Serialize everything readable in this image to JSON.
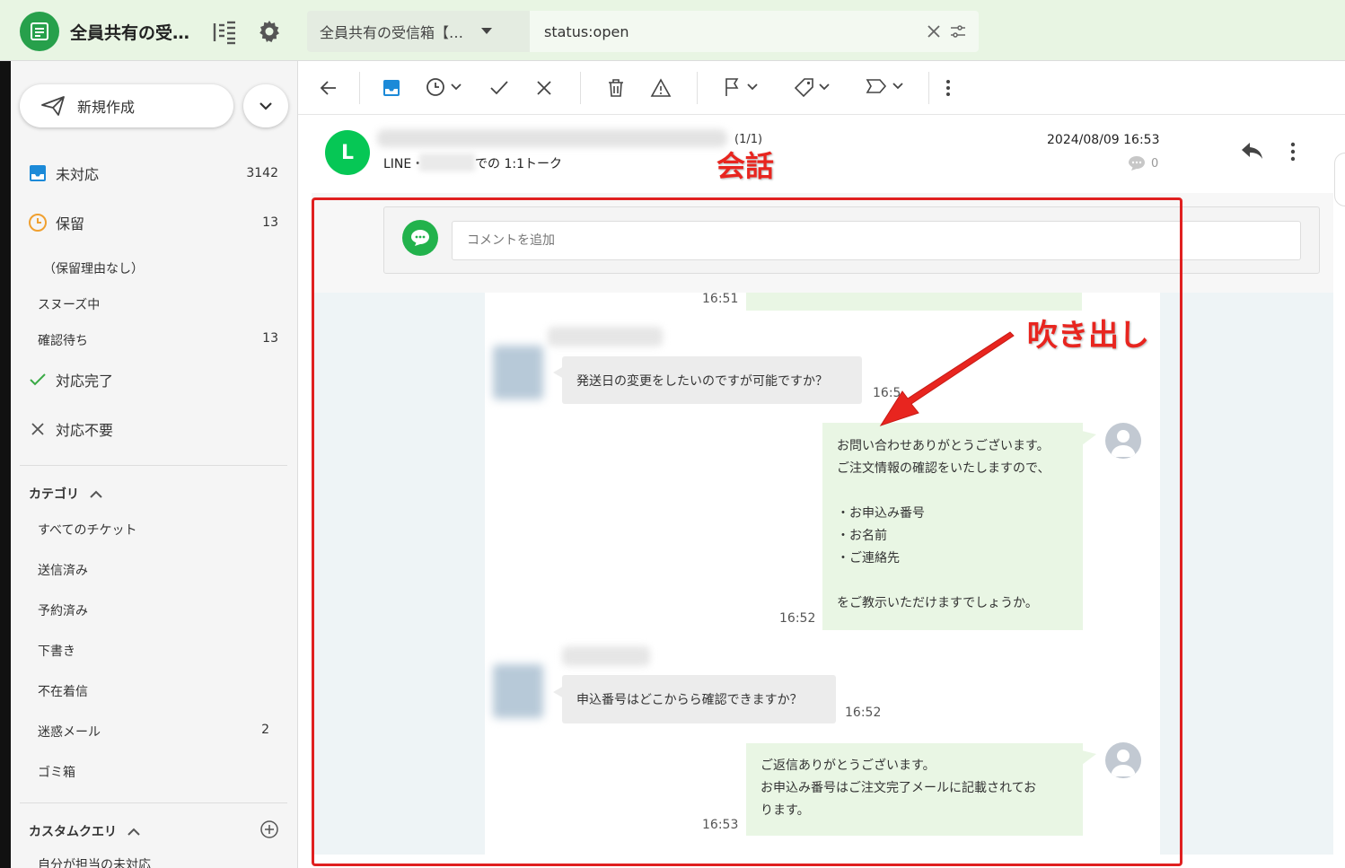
{
  "app": {
    "title": "全員共有の受…"
  },
  "compose": {
    "label": "新規作成"
  },
  "nav": [
    {
      "label": "未対応",
      "count": "3142"
    },
    {
      "label": "保留",
      "count": "13"
    },
    {
      "label": "対応完了"
    },
    {
      "label": "対応不要"
    }
  ],
  "hold_sub": [
    {
      "label": "（保留理由なし）"
    },
    {
      "label": "スヌーズ中"
    },
    {
      "label": "確認待ち",
      "count": "13"
    }
  ],
  "category": {
    "heading": "カテゴリ",
    "items": [
      {
        "label": "すべてのチケット"
      },
      {
        "label": "送信済み"
      },
      {
        "label": "予約済み"
      },
      {
        "label": "下書き"
      },
      {
        "label": "不在着信"
      },
      {
        "label": "迷惑メール",
        "count": "2"
      },
      {
        "label": "ゴミ箱"
      }
    ]
  },
  "custom_query": {
    "heading": "カスタムクエリ",
    "first_item": "自分が担当の未対応"
  },
  "topbar": {
    "inbox": "全員共有の受信箱【…",
    "search": "status:open"
  },
  "header": {
    "avatar_letter": "L",
    "page_count": "(1/1)",
    "line_prefix": "LINE・",
    "talk_label": "での 1:1トーク",
    "date": "2024/08/09 16:53",
    "comment_count": "0"
  },
  "annotations": {
    "kaiwa": "会話",
    "fukidashi": "吹き出し"
  },
  "comment": {
    "placeholder": "コメントを追加"
  },
  "messages": {
    "t0": "16:51",
    "m1": {
      "text": "発送日の変更をしたいのですが可能ですか？",
      "time": "16:5"
    },
    "m2": {
      "lines": [
        "お問い合わせありがとうございます。",
        "ご注文情報の確認をいたしますので、",
        "",
        "・お申込み番号",
        "・お名前",
        "・ご連絡先",
        "",
        "をご教示いただけますでしょうか。"
      ],
      "time": "16:52"
    },
    "m3": {
      "text": "申込番号はどこからら確認できますか？",
      "time": "16:52"
    },
    "m4": {
      "lines": [
        "ご返信ありがとうございます。",
        "お申込み番号はご注文完了メールに記載されてお",
        "ります。"
      ],
      "time": "16:53"
    }
  },
  "colors": {
    "brand_green": "#27a04b",
    "line_green": "#06c755",
    "annotation_red": "#e02020",
    "outgoing_bubble": "#e9f6e4"
  }
}
